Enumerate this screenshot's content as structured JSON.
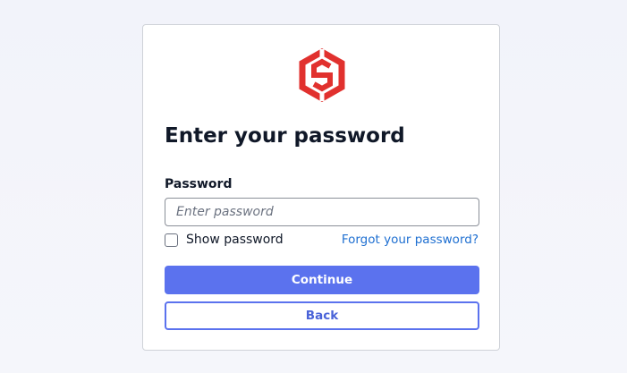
{
  "login": {
    "title": "Enter your password",
    "password_label": "Password",
    "password_placeholder": "Enter password",
    "password_value": "",
    "show_password_label": "Show password",
    "show_password_checked": false,
    "forgot_link": "Forgot your password?",
    "continue_label": "Continue",
    "back_label": "Back"
  },
  "colors": {
    "brand_logo": "#e1312e",
    "primary_button": "#5b72ee",
    "link": "#1e6fd1"
  },
  "icons": {
    "logo": "hexagon-s-logo-icon"
  }
}
